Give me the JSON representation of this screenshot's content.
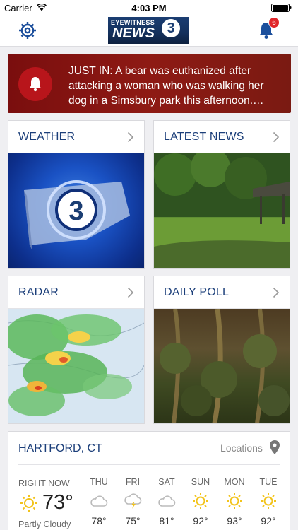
{
  "status_bar": {
    "carrier": "Carrier",
    "time": "4:03 PM"
  },
  "nav": {
    "logo_top": "EYEWITNESS",
    "logo_main": "NEWS",
    "logo_number": "3",
    "notification_count": "6"
  },
  "alert": {
    "text": "JUST IN: A bear was euthanized after attacking a woman who was walking her dog in a Simsbury park this afternoon.…"
  },
  "cards": [
    {
      "title": "WEATHER"
    },
    {
      "title": "LATEST NEWS"
    },
    {
      "title": "RADAR"
    },
    {
      "title": "DAILY POLL"
    }
  ],
  "weather": {
    "city": "HARTFORD, CT",
    "locations_label": "Locations",
    "now": {
      "label": "RIGHT NOW",
      "temp": "73°",
      "condition": "Partly Cloudy",
      "icon": "sun-icon"
    },
    "days": [
      {
        "day": "THU",
        "temp": "78°",
        "icon": "cloud-icon"
      },
      {
        "day": "FRI",
        "temp": "75°",
        "icon": "storm-icon"
      },
      {
        "day": "SAT",
        "temp": "81°",
        "icon": "cloud-icon"
      },
      {
        "day": "SUN",
        "temp": "92°",
        "icon": "sun-icon"
      },
      {
        "day": "MON",
        "temp": "93°",
        "icon": "sun-icon"
      },
      {
        "day": "TUE",
        "temp": "92°",
        "icon": "sun-icon"
      }
    ]
  },
  "colors": {
    "accent": "#1c3f7a",
    "alert": "#8e1a14",
    "sun": "#f2c31b",
    "badge": "#e0262b"
  }
}
